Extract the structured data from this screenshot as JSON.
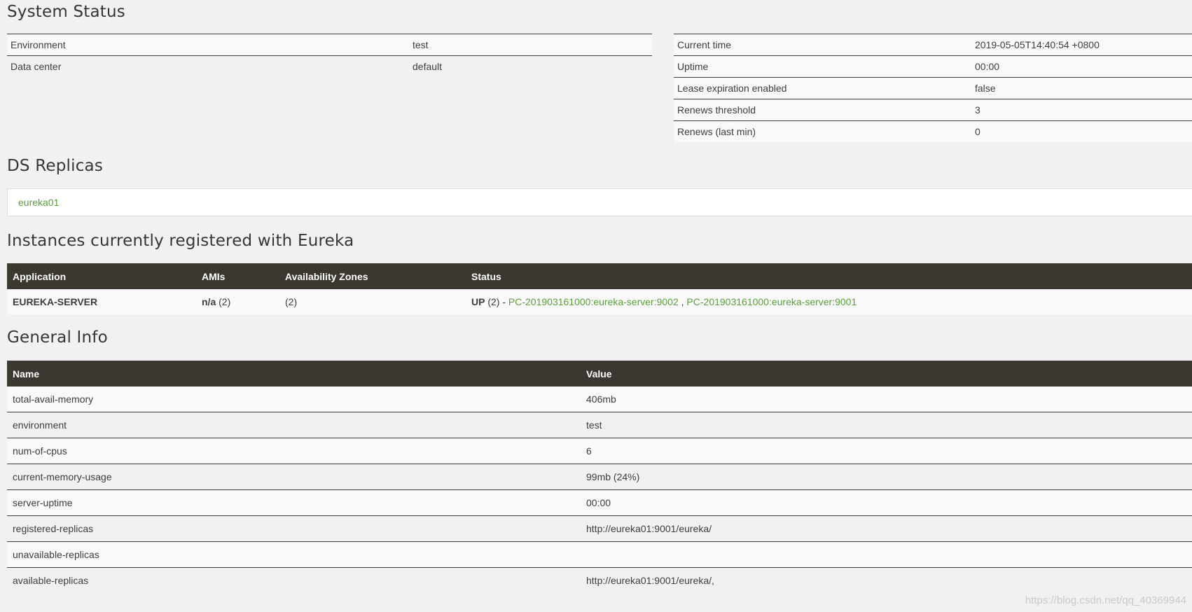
{
  "system_status": {
    "title": "System Status",
    "left_rows": [
      {
        "label": "Environment",
        "value": "test"
      },
      {
        "label": "Data center",
        "value": "default"
      }
    ],
    "right_rows": [
      {
        "label": "Current time",
        "value": "2019-05-05T14:40:54 +0800"
      },
      {
        "label": "Uptime",
        "value": "00:00"
      },
      {
        "label": "Lease expiration enabled",
        "value": "false"
      },
      {
        "label": "Renews threshold",
        "value": "3"
      },
      {
        "label": "Renews (last min)",
        "value": "0"
      }
    ]
  },
  "ds_replicas": {
    "title": "DS Replicas",
    "items": [
      "eureka01"
    ]
  },
  "instances": {
    "title": "Instances currently registered with Eureka",
    "headers": [
      "Application",
      "AMIs",
      "Availability Zones",
      "Status"
    ],
    "rows": [
      {
        "application": "EUREKA-SERVER",
        "amis_bold": "n/a",
        "amis_count": "(2)",
        "zones": "(2)",
        "status_bold": "UP",
        "status_count": "(2) -",
        "links": [
          "PC-201903161000:eureka-server:9002",
          "PC-201903161000:eureka-server:9001"
        ],
        "separator": ","
      }
    ]
  },
  "general_info": {
    "title": "General Info",
    "headers": [
      "Name",
      "Value"
    ],
    "rows": [
      {
        "name": "total-avail-memory",
        "value": "406mb"
      },
      {
        "name": "environment",
        "value": "test"
      },
      {
        "name": "num-of-cpus",
        "value": "6"
      },
      {
        "name": "current-memory-usage",
        "value": "99mb (24%)"
      },
      {
        "name": "server-uptime",
        "value": "00:00"
      },
      {
        "name": "registered-replicas",
        "value": "http://eureka01:9001/eureka/"
      },
      {
        "name": "unavailable-replicas",
        "value": ""
      },
      {
        "name": "available-replicas",
        "value": "http://eureka01:9001/eureka/,"
      }
    ]
  },
  "watermark": "https://blog.csdn.net/qq_40369944",
  "colors": {
    "link": "#5a9f3a",
    "header_bg": "#3b3731",
    "page_bg": "#f1f1f1"
  }
}
